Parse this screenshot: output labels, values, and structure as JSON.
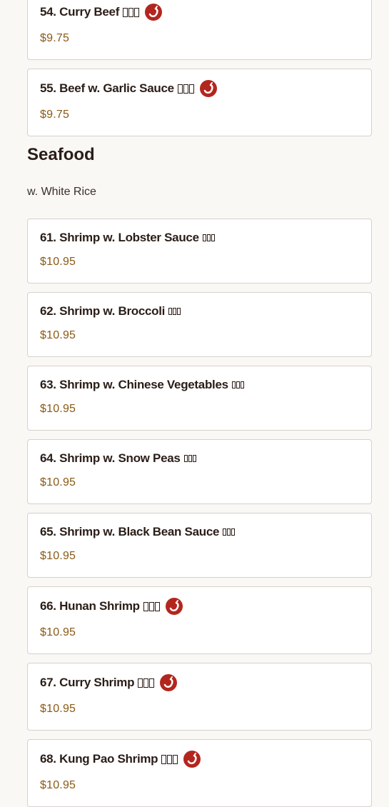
{
  "colors": {
    "background": "#faf8f5",
    "card_border": "#d4d1cd",
    "title": "#2a1d17",
    "price": "#8a5a16",
    "spicy": "#b3261e"
  },
  "sections": {
    "beef_tail": [
      {
        "name": "54. Curry Beef",
        "price": "$9.75",
        "spicy": true
      },
      {
        "name": "55. Beef w. Garlic Sauce",
        "price": "$9.75",
        "spicy": true
      }
    ],
    "seafood": {
      "title": "Seafood",
      "subtitle": "w. White Rice",
      "items": [
        {
          "name": "61. Shrimp w. Lobster Sauce",
          "price": "$10.95",
          "spicy": false
        },
        {
          "name": "62. Shrimp w. Broccoli",
          "price": "$10.95",
          "spicy": false
        },
        {
          "name": "63. Shrimp w. Chinese Vegetables",
          "price": "$10.95",
          "spicy": false
        },
        {
          "name": "64. Shrimp w. Snow Peas",
          "price": "$10.95",
          "spicy": false
        },
        {
          "name": "65. Shrimp w. Black Bean Sauce",
          "price": "$10.95",
          "spicy": false
        },
        {
          "name": "66. Hunan Shrimp",
          "price": "$10.95",
          "spicy": true
        },
        {
          "name": "67. Curry Shrimp",
          "price": "$10.95",
          "spicy": true
        },
        {
          "name": "68. Kung Pao Shrimp",
          "price": "$10.95",
          "spicy": true
        }
      ]
    }
  },
  "icons": {
    "spicy": "chili-pepper-icon",
    "missing_glyph": "missing-glyph-box"
  }
}
